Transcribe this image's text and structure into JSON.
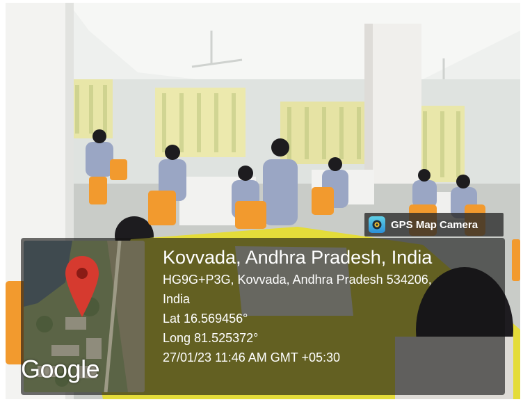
{
  "badge": {
    "label": "GPS Map Camera",
    "icon": "camera-lens-icon"
  },
  "map": {
    "logo_text": "Google",
    "pin_icon": "map-pin-icon",
    "pin_color": "#d63a2f"
  },
  "location": {
    "title": "Kovvada, Andhra Pradesh, India",
    "address_line1": "HG9G+P3G, Kovvada, Andhra Pradesh 534206,",
    "address_line2": "India",
    "latitude": "Lat 16.569456°",
    "longitude": "Long 81.525372°",
    "timestamp": "27/01/23 11:46 AM GMT +05:30"
  },
  "colors": {
    "overlay": "#141414",
    "table_yellow": "#e4dc3a",
    "chairs": "#f29a2e"
  }
}
